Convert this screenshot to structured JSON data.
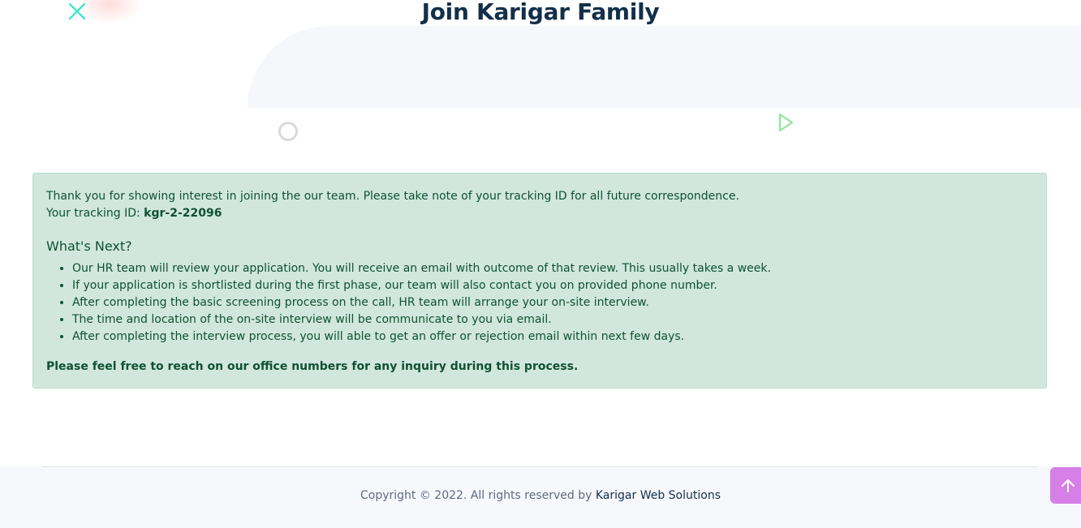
{
  "hero": {
    "title": "Join Karigar Family"
  },
  "alert": {
    "intro": "Thank you for showing interest in joining the our team. Please take note of your tracking ID for all future correspondence.",
    "tracking_label": "Your tracking ID: ",
    "tracking_id": "kgr-2-22096",
    "next_heading": "What's Next?",
    "steps": [
      "Our HR team will review your application. You will receive an email with outcome of that review. This usually takes a week.",
      "If your application is shortlisted during the first phase, our team will also contact you on provided phone number.",
      "After completing the basic screening process on the call, HR team will arrange your on-site interview.",
      "The time and location of the on-site interview will be communicate to you via email.",
      "After completing the interview process, you will able to get an offer or rejection email within next few days."
    ],
    "closing": "Please feel free to reach on our office numbers for any inquiry during this process."
  },
  "footer": {
    "copyright_prefix": "Copyright © 2022. All rights reserved by ",
    "company": "Karigar Web Solutions"
  },
  "icons": {
    "back_to_top": "arrow-up-icon",
    "decorations": [
      "x-shape-icon",
      "circle-shape-icon",
      "triangle-shape-icon"
    ]
  },
  "colors": {
    "title": "#12304a",
    "alert_bg": "#d1e7dd",
    "alert_text": "#0f5132",
    "back_to_top": "#d67fe6",
    "x_shape": "#2ee6c5",
    "triangle_shape": "#8ee89a"
  }
}
